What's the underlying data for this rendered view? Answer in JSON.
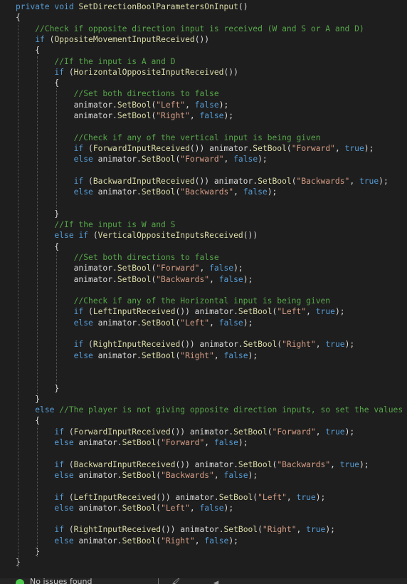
{
  "code": {
    "lines": [
      [
        [
          "kw",
          "private"
        ],
        [
          "pl",
          " "
        ],
        [
          "kw",
          "void"
        ],
        [
          "pl",
          " "
        ],
        [
          "fn",
          "SetDirectionBoolParametersOnInput"
        ],
        [
          "pl",
          "()"
        ]
      ],
      [
        [
          "pl",
          "{"
        ]
      ],
      [
        [
          "pl",
          "    "
        ],
        [
          "cm",
          "//Check if opposite direction input is received (W and S or A and D)"
        ]
      ],
      [
        [
          "pl",
          "    "
        ],
        [
          "kw",
          "if"
        ],
        [
          "pl",
          " ("
        ],
        [
          "fn",
          "OppositeMovementInputReceived"
        ],
        [
          "pl",
          "())"
        ]
      ],
      [
        [
          "pl",
          "    {"
        ]
      ],
      [
        [
          "pl",
          "        "
        ],
        [
          "cm",
          "//If the input is A and D"
        ]
      ],
      [
        [
          "pl",
          "        "
        ],
        [
          "kw",
          "if"
        ],
        [
          "pl",
          " ("
        ],
        [
          "fn",
          "HorizontalOppositeInputReceived"
        ],
        [
          "pl",
          "())"
        ]
      ],
      [
        [
          "pl",
          "        {"
        ]
      ],
      [
        [
          "pl",
          "            "
        ],
        [
          "cm",
          "//Set both directions to false"
        ]
      ],
      [
        [
          "pl",
          "            animator."
        ],
        [
          "fn",
          "SetBool"
        ],
        [
          "pl",
          "("
        ],
        [
          "str",
          "\"Left\""
        ],
        [
          "pl",
          ", "
        ],
        [
          "kw",
          "false"
        ],
        [
          "pl",
          ");"
        ]
      ],
      [
        [
          "pl",
          "            animator."
        ],
        [
          "fn",
          "SetBool"
        ],
        [
          "pl",
          "("
        ],
        [
          "str",
          "\"Right\""
        ],
        [
          "pl",
          ", "
        ],
        [
          "kw",
          "false"
        ],
        [
          "pl",
          ");"
        ]
      ],
      [],
      [
        [
          "pl",
          "            "
        ],
        [
          "cm",
          "//Check if any of the vertical input is being given"
        ]
      ],
      [
        [
          "pl",
          "            "
        ],
        [
          "kw",
          "if"
        ],
        [
          "pl",
          " ("
        ],
        [
          "fn",
          "ForwardInputReceived"
        ],
        [
          "pl",
          "()) animator."
        ],
        [
          "fn",
          "SetBool"
        ],
        [
          "pl",
          "("
        ],
        [
          "str",
          "\"Forward\""
        ],
        [
          "pl",
          ", "
        ],
        [
          "kw",
          "true"
        ],
        [
          "pl",
          ");"
        ]
      ],
      [
        [
          "pl",
          "            "
        ],
        [
          "kw",
          "else"
        ],
        [
          "pl",
          " animator."
        ],
        [
          "fn",
          "SetBool"
        ],
        [
          "pl",
          "("
        ],
        [
          "str",
          "\"Forward\""
        ],
        [
          "pl",
          ", "
        ],
        [
          "kw",
          "false"
        ],
        [
          "pl",
          ");"
        ]
      ],
      [],
      [
        [
          "pl",
          "            "
        ],
        [
          "kw",
          "if"
        ],
        [
          "pl",
          " ("
        ],
        [
          "fn",
          "BackwardInputReceived"
        ],
        [
          "pl",
          "()) animator."
        ],
        [
          "fn",
          "SetBool"
        ],
        [
          "pl",
          "("
        ],
        [
          "str",
          "\"Backwards\""
        ],
        [
          "pl",
          ", "
        ],
        [
          "kw",
          "true"
        ],
        [
          "pl",
          ");"
        ]
      ],
      [
        [
          "pl",
          "            "
        ],
        [
          "kw",
          "else"
        ],
        [
          "pl",
          " animator."
        ],
        [
          "fn",
          "SetBool"
        ],
        [
          "pl",
          "("
        ],
        [
          "str",
          "\"Backwards\""
        ],
        [
          "pl",
          ", "
        ],
        [
          "kw",
          "false"
        ],
        [
          "pl",
          ");"
        ]
      ],
      [],
      [
        [
          "pl",
          "        }"
        ]
      ],
      [
        [
          "pl",
          "        "
        ],
        [
          "cm",
          "//If the input is W and S"
        ]
      ],
      [
        [
          "pl",
          "        "
        ],
        [
          "kw",
          "else"
        ],
        [
          "pl",
          " "
        ],
        [
          "kw",
          "if"
        ],
        [
          "pl",
          " ("
        ],
        [
          "fn",
          "VerticalOppositeInputsReceived"
        ],
        [
          "pl",
          "())"
        ]
      ],
      [
        [
          "pl",
          "        {"
        ]
      ],
      [
        [
          "pl",
          "            "
        ],
        [
          "cm",
          "//Set both directions to false"
        ]
      ],
      [
        [
          "pl",
          "            animator."
        ],
        [
          "fn",
          "SetBool"
        ],
        [
          "pl",
          "("
        ],
        [
          "str",
          "\"Forward\""
        ],
        [
          "pl",
          ", "
        ],
        [
          "kw",
          "false"
        ],
        [
          "pl",
          ");"
        ]
      ],
      [
        [
          "pl",
          "            animator."
        ],
        [
          "fn",
          "SetBool"
        ],
        [
          "pl",
          "("
        ],
        [
          "str",
          "\"Backwards\""
        ],
        [
          "pl",
          ", "
        ],
        [
          "kw",
          "false"
        ],
        [
          "pl",
          ");"
        ]
      ],
      [],
      [
        [
          "pl",
          "            "
        ],
        [
          "cm",
          "//Check if any of the Horizontal input is being given"
        ]
      ],
      [
        [
          "pl",
          "            "
        ],
        [
          "kw",
          "if"
        ],
        [
          "pl",
          " ("
        ],
        [
          "fn",
          "LeftInputReceived"
        ],
        [
          "pl",
          "()) animator."
        ],
        [
          "fn",
          "SetBool"
        ],
        [
          "pl",
          "("
        ],
        [
          "str",
          "\"Left\""
        ],
        [
          "pl",
          ", "
        ],
        [
          "kw",
          "true"
        ],
        [
          "pl",
          ");"
        ]
      ],
      [
        [
          "pl",
          "            "
        ],
        [
          "kw",
          "else"
        ],
        [
          "pl",
          " animator."
        ],
        [
          "fn",
          "SetBool"
        ],
        [
          "pl",
          "("
        ],
        [
          "str",
          "\"Left\""
        ],
        [
          "pl",
          ", "
        ],
        [
          "kw",
          "false"
        ],
        [
          "pl",
          ");"
        ]
      ],
      [],
      [
        [
          "pl",
          "            "
        ],
        [
          "kw",
          "if"
        ],
        [
          "pl",
          " ("
        ],
        [
          "fn",
          "RightInputReceived"
        ],
        [
          "pl",
          "()) animator."
        ],
        [
          "fn",
          "SetBool"
        ],
        [
          "pl",
          "("
        ],
        [
          "str",
          "\"Right\""
        ],
        [
          "pl",
          ", "
        ],
        [
          "kw",
          "true"
        ],
        [
          "pl",
          ");"
        ]
      ],
      [
        [
          "pl",
          "            "
        ],
        [
          "kw",
          "else"
        ],
        [
          "pl",
          " animator."
        ],
        [
          "fn",
          "SetBool"
        ],
        [
          "pl",
          "("
        ],
        [
          "str",
          "\"Right\""
        ],
        [
          "pl",
          ", "
        ],
        [
          "kw",
          "false"
        ],
        [
          "pl",
          ");"
        ]
      ],
      [],
      [],
      [
        [
          "pl",
          "        }"
        ]
      ],
      [
        [
          "pl",
          "    }"
        ]
      ],
      [
        [
          "pl",
          "    "
        ],
        [
          "kw",
          "else"
        ],
        [
          "pl",
          " "
        ],
        [
          "cm",
          "//The player is not giving opposite direction inputs, so set the values"
        ]
      ],
      [
        [
          "pl",
          "    {"
        ]
      ],
      [
        [
          "pl",
          "        "
        ],
        [
          "kw",
          "if"
        ],
        [
          "pl",
          " ("
        ],
        [
          "fn",
          "ForwardInputReceived"
        ],
        [
          "pl",
          "()) animator."
        ],
        [
          "fn",
          "SetBool"
        ],
        [
          "pl",
          "("
        ],
        [
          "str",
          "\"Forward\""
        ],
        [
          "pl",
          ", "
        ],
        [
          "kw",
          "true"
        ],
        [
          "pl",
          ");"
        ]
      ],
      [
        [
          "pl",
          "        "
        ],
        [
          "kw",
          "else"
        ],
        [
          "pl",
          " animator."
        ],
        [
          "fn",
          "SetBool"
        ],
        [
          "pl",
          "("
        ],
        [
          "str",
          "\"Forward\""
        ],
        [
          "pl",
          ", "
        ],
        [
          "kw",
          "false"
        ],
        [
          "pl",
          ");"
        ]
      ],
      [],
      [
        [
          "pl",
          "        "
        ],
        [
          "kw",
          "if"
        ],
        [
          "pl",
          " ("
        ],
        [
          "fn",
          "BackwardInputReceived"
        ],
        [
          "pl",
          "()) animator."
        ],
        [
          "fn",
          "SetBool"
        ],
        [
          "pl",
          "("
        ],
        [
          "str",
          "\"Backwards\""
        ],
        [
          "pl",
          ", "
        ],
        [
          "kw",
          "true"
        ],
        [
          "pl",
          ");"
        ]
      ],
      [
        [
          "pl",
          "        "
        ],
        [
          "kw",
          "else"
        ],
        [
          "pl",
          " animator."
        ],
        [
          "fn",
          "SetBool"
        ],
        [
          "pl",
          "("
        ],
        [
          "str",
          "\"Backwards\""
        ],
        [
          "pl",
          ", "
        ],
        [
          "kw",
          "false"
        ],
        [
          "pl",
          ");"
        ]
      ],
      [],
      [
        [
          "pl",
          "        "
        ],
        [
          "kw",
          "if"
        ],
        [
          "pl",
          " ("
        ],
        [
          "fn",
          "LeftInputReceived"
        ],
        [
          "pl",
          "()) animator."
        ],
        [
          "fn",
          "SetBool"
        ],
        [
          "pl",
          "("
        ],
        [
          "str",
          "\"Left\""
        ],
        [
          "pl",
          ", "
        ],
        [
          "kw",
          "true"
        ],
        [
          "pl",
          ");"
        ]
      ],
      [
        [
          "pl",
          "        "
        ],
        [
          "kw",
          "else"
        ],
        [
          "pl",
          " animator."
        ],
        [
          "fn",
          "SetBool"
        ],
        [
          "pl",
          "("
        ],
        [
          "str",
          "\"Left\""
        ],
        [
          "pl",
          ", "
        ],
        [
          "kw",
          "false"
        ],
        [
          "pl",
          ");"
        ]
      ],
      [],
      [
        [
          "pl",
          "        "
        ],
        [
          "kw",
          "if"
        ],
        [
          "pl",
          " ("
        ],
        [
          "fn",
          "RightInputReceived"
        ],
        [
          "pl",
          "()) animator."
        ],
        [
          "fn",
          "SetBool"
        ],
        [
          "pl",
          "("
        ],
        [
          "str",
          "\"Right\""
        ],
        [
          "pl",
          ", "
        ],
        [
          "kw",
          "true"
        ],
        [
          "pl",
          ");"
        ]
      ],
      [
        [
          "pl",
          "        "
        ],
        [
          "kw",
          "else"
        ],
        [
          "pl",
          " animator."
        ],
        [
          "fn",
          "SetBool"
        ],
        [
          "pl",
          "("
        ],
        [
          "str",
          "\"Right\""
        ],
        [
          "pl",
          ", "
        ],
        [
          "kw",
          "false"
        ],
        [
          "pl",
          ");"
        ]
      ],
      [
        [
          "pl",
          "    }"
        ]
      ],
      [
        [
          "pl",
          "}"
        ]
      ]
    ]
  },
  "colors": {
    "background": "#1e1e1e",
    "keyword": "#569cd6",
    "method": "#dcdcaa",
    "string": "#d69d85",
    "comment": "#57a64a",
    "plain": "#dcdcdc",
    "status_ok": "#4ec94e"
  },
  "statusbar": {
    "status_text": "No issues found",
    "status_icon": "check-circle-icon",
    "cleanup_icon": "brush-icon",
    "nav_icon": "arrow-icon"
  }
}
